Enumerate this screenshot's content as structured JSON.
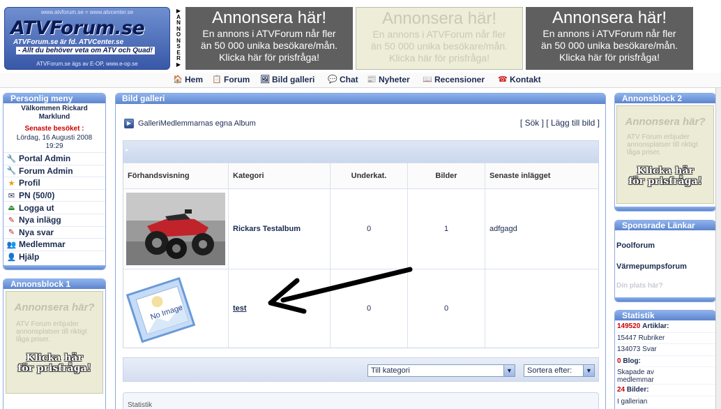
{
  "header": {
    "logo": {
      "top_url": "www.atvforum.se = www.atvcenter.se",
      "name": "ATVForum.se",
      "sub1": "ATVForum.se är fd. ATVCenter.se",
      "sub2": "- Allt du behöver veta om ATV och Quad!",
      "bottom": "ATVForum.se ägs av E-OP, www.e-op.se"
    },
    "annonser_vertical": "ANNONSER",
    "banners": [
      {
        "title": "Annonsera här!",
        "lines": [
          "En annons i ATVForum når fler",
          "än 50 000 unika besökare/mån.",
          "Klicka här för prisfråga!"
        ]
      },
      {
        "title": "Annonsera här!",
        "lines": [
          "En annons i ATVForum når fler",
          "än 50 000 unika besökare/mån.",
          "Klicka här för prisfråga!"
        ]
      },
      {
        "title": "Annonsera här!",
        "lines": [
          "En annons i ATVForum når fler",
          "än 50 000 unika besökare/mån.",
          "Klicka här för prisfråga!"
        ]
      }
    ]
  },
  "nav": {
    "items": [
      {
        "label": "Hem",
        "icon": "home-icon"
      },
      {
        "label": "Forum",
        "icon": "forum-icon"
      },
      {
        "label": "Bild galleri",
        "icon": "gallery-icon"
      },
      {
        "label": "Chat",
        "icon": "chat-icon"
      },
      {
        "label": "Nyheter",
        "icon": "news-icon"
      },
      {
        "label": "Recensioner",
        "icon": "reviews-icon"
      },
      {
        "label": "Kontakt",
        "icon": "phone-icon"
      }
    ]
  },
  "menu": {
    "title": "Personlig meny",
    "welcome_line1": "Välkommen Rickard",
    "welcome_line2": "Marklund",
    "last_visit_label": "Senaste besöket :",
    "last_visit_line1": "Lördag, 16 Augusti 2008",
    "last_visit_line2": "19:29",
    "links": [
      {
        "label": "Portal Admin",
        "icon": "tools-icon"
      },
      {
        "label": "Forum Admin",
        "icon": "tools-icon"
      },
      {
        "label": "Profil",
        "icon": "star-icon"
      },
      {
        "label": "PN (50/0)",
        "icon": "message-icon"
      },
      {
        "label": "Logga ut",
        "icon": "logout-icon"
      },
      {
        "label": "Nya inlägg",
        "icon": "new-posts-icon"
      },
      {
        "label": "Nya svar",
        "icon": "new-replies-icon"
      },
      {
        "label": "Medlemmar",
        "icon": "members-icon"
      },
      {
        "label": "Hjälp",
        "icon": "help-icon"
      }
    ]
  },
  "ad_left": {
    "title": "Annonsblock 1",
    "head": "Annonsera här?",
    "line1": "ATV Forum erbjuder",
    "line2": "annonsplatser till riktigt",
    "line3": "låga priser.",
    "cta1": "Klicka här",
    "cta2": "för prisfråga!"
  },
  "main": {
    "title": "Bild galleri",
    "breadcrumb": "GalleriMedlemmarnas egna Album",
    "search_link": "[ Sök ]",
    "add_link": "[ Lägg till bild ]",
    "table": {
      "topbar_marker": "▸",
      "headers": [
        "Förhandsvisning",
        "Kategori",
        "Underkat.",
        "Bilder",
        "Senaste inlägget"
      ],
      "rows": [
        {
          "category": "Rickars Testalbum",
          "subcats": "0",
          "images": "1",
          "latest": "adfgagd",
          "thumb": "atv-photo"
        },
        {
          "category": "test",
          "subcats": "0",
          "images": "0",
          "latest": "",
          "thumb": "no-image",
          "thumb_text": "No Image"
        }
      ]
    },
    "sort": {
      "category_select": "Till kategori",
      "sort_select": "Sortera efter:"
    },
    "stats_heading": "Statistik"
  },
  "ad_right": {
    "title": "Annonsblock 2",
    "head": "Annonsera här?",
    "line1": "ATV Forum erbjuder",
    "line2": "annonsplatser till riktigt",
    "line3": "låga priser.",
    "cta1": "Klicka här",
    "cta2": "för prisfråga!"
  },
  "sponsors": {
    "title": "Sponsrade Länkar",
    "links": [
      "Poolforum",
      "Värmepumpsforum",
      "Din plats här?"
    ]
  },
  "stats": {
    "title": "Statistik",
    "articles_count": "149520",
    "articles_label": "Artiklar:",
    "rubriker": "15447 Rubriker",
    "svar": "134073 Svar",
    "blog_count": "0",
    "blog_label": "Blog:",
    "blog_line1": "Skapade av",
    "blog_line2": "medlemmar",
    "images_count": "24",
    "images_label": "Bilder:",
    "images_line": "I gallerian"
  }
}
